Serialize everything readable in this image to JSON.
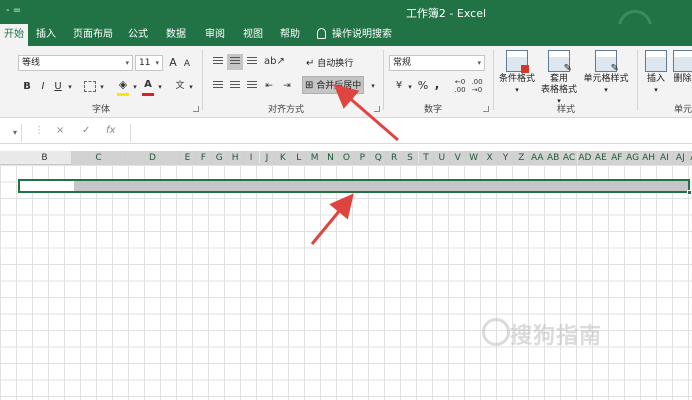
{
  "window": {
    "title": "工作簿2  -  Excel",
    "quick_access": "- ="
  },
  "tabs": [
    {
      "label": "开始",
      "active": true
    },
    {
      "label": "插入"
    },
    {
      "label": "页面布局"
    },
    {
      "label": "公式"
    },
    {
      "label": "数据"
    },
    {
      "label": "审阅"
    },
    {
      "label": "视图"
    },
    {
      "label": "帮助"
    },
    {
      "label": "操作说明搜索"
    }
  ],
  "ribbon": {
    "font": {
      "font_name": "等线",
      "font_size": "11",
      "grow": "A",
      "shrink": "A",
      "bold": "B",
      "italic": "I",
      "underline": "U",
      "font_color_letter": "A",
      "phonetic": "文",
      "group_label": "字体"
    },
    "alignment": {
      "wrap_text": "自动换行",
      "merge_center": "合并后居中",
      "group_label": "对齐方式"
    },
    "number": {
      "format": "常规",
      "percent": "%",
      "comma": ",",
      "group_label": "数字"
    },
    "styles": {
      "conditional": "条件格式",
      "table_format_1": "套用",
      "table_format_2": "表格格式",
      "cell_styles": "单元格样式",
      "group_label": "样式"
    },
    "cells": {
      "insert": "插入",
      "delete": "删除",
      "group_label": "单元"
    }
  },
  "formula_bar": {
    "fx": "fx",
    "cancel": "×",
    "enter": "✓",
    "value": ""
  },
  "columns": [
    "B",
    "C",
    "D",
    "E",
    "F",
    "G",
    "H",
    "I",
    "J",
    "K",
    "L",
    "M",
    "N",
    "O",
    "P",
    "Q",
    "R",
    "S",
    "T",
    "U",
    "V",
    "W",
    "X",
    "Y",
    "Z",
    "AA",
    "AB",
    "AC",
    "AD",
    "AE",
    "AF",
    "AG",
    "AH",
    "AI",
    "AJ",
    "AK"
  ],
  "watermark": "搜狗指南",
  "colors": {
    "excel_green": "#217346",
    "arrow_red": "#e0443e",
    "selection_gray": "#c6c6c6"
  }
}
